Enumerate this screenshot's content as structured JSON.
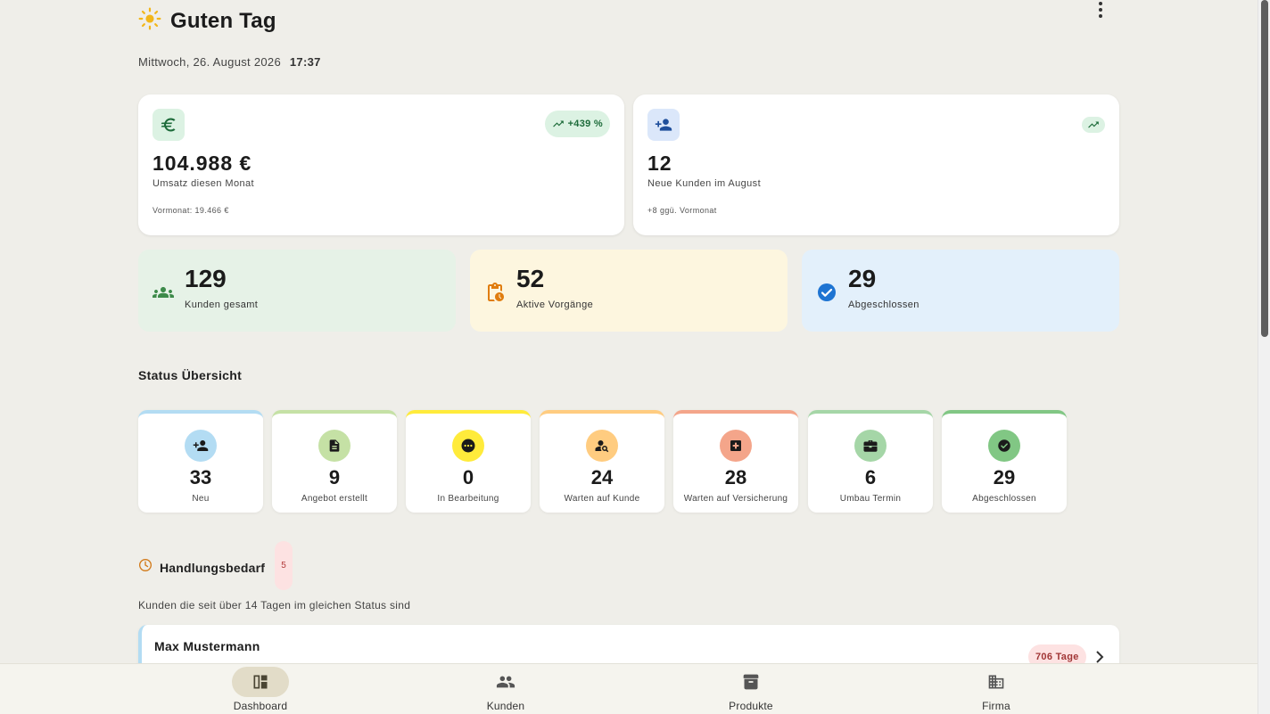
{
  "header": {
    "greeting": "Guten Tag",
    "greeting_icon": "sun-icon",
    "date": "Mittwoch, 26. August 2026",
    "time": "17:37",
    "menu_icon": "more-vert-icon"
  },
  "revenue_card": {
    "icon": "euro-icon",
    "value": "104.988 €",
    "label": "Umsatz diesen Monat",
    "sub": "Vormonat: 19.466 €",
    "trend": "+439 %",
    "trend_icon": "trending-up-icon"
  },
  "customers_card": {
    "icon": "person-add-icon",
    "value": "12",
    "label": "Neue Kunden im August",
    "sub": "+8 ggü. Vormonat",
    "trend_icon": "trending-up-icon"
  },
  "tiles": [
    {
      "value": "129",
      "label": "Kunden gesamt",
      "icon": "groups-icon",
      "color": "#e6f2e7"
    },
    {
      "value": "52",
      "label": "Aktive Vorgänge",
      "icon": "pending-clipboard-icon",
      "color": "#fdf6df"
    },
    {
      "value": "29",
      "label": "Abgeschlossen",
      "icon": "check-circle-icon",
      "color": "#e3f0fb"
    }
  ],
  "status_section": {
    "title": "Status Übersicht",
    "items": [
      {
        "value": "33",
        "label": "Neu",
        "icon": "person-add-icon",
        "color": "#b3dcf3"
      },
      {
        "value": "9",
        "label": "Angebot erstellt",
        "icon": "document-icon",
        "color": "#c5e1a5"
      },
      {
        "value": "0",
        "label": "In Bearbeitung",
        "icon": "pending-icon",
        "color": "#ffeb3b"
      },
      {
        "value": "24",
        "label": "Warten auf Kunde",
        "icon": "person-search-icon",
        "color": "#ffcc80"
      },
      {
        "value": "28",
        "label": "Warten auf Versicherung",
        "icon": "medical-icon",
        "color": "#f4a58a"
      },
      {
        "value": "6",
        "label": "Umbau Termin",
        "icon": "toolbox-icon",
        "color": "#a5d6a7"
      },
      {
        "value": "29",
        "label": "Abgeschlossen",
        "icon": "check-circle-icon",
        "color": "#81c784"
      }
    ]
  },
  "action_section": {
    "title": "Handlungsbedarf",
    "count": "5",
    "subtitle": "Kunden die seit über 14 Tagen im gleichen Status sind",
    "items": [
      {
        "name": "Max Mustermann",
        "days": "706 Tage"
      }
    ]
  },
  "bottom_nav": [
    {
      "label": "Dashboard",
      "icon": "dashboard-icon",
      "active": true
    },
    {
      "label": "Kunden",
      "icon": "people-icon",
      "active": false
    },
    {
      "label": "Produkte",
      "icon": "archive-box-icon",
      "active": false
    },
    {
      "label": "Firma",
      "icon": "building-icon",
      "active": false
    }
  ]
}
